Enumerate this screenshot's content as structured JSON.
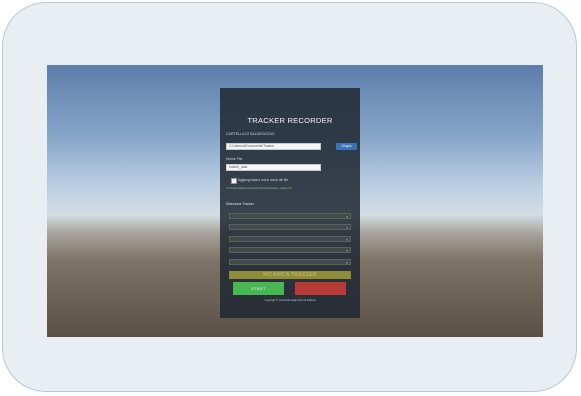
{
  "app": {
    "title": "TRACKER RECORDER"
  },
  "save_folder": {
    "label": "CARTELLA DI SALVATAGGIO",
    "value": "C:/Users/a/Documents/Tracker",
    "browse_label": "Sfoglia"
  },
  "file_name": {
    "label": "Nome File",
    "value": "tracker_data"
  },
  "timestamp_option": {
    "label": "Aggiungi data e ora al nome del file",
    "checked": false
  },
  "path_preview": "C:/Users/a/Documents/Tracker/tracker_data.csv",
  "trackers": {
    "section_label": "Seleziona Tracker",
    "dropdowns": [
      "",
      "",
      "",
      "",
      ""
    ]
  },
  "buttons": {
    "load_label": "RICARICA TRACKER",
    "start_label": "START",
    "stop_label": ""
  },
  "footer": "Copyright © Università degli Studi di Padova",
  "colors": {
    "panel": "#202832",
    "start": "#49b654",
    "stop": "#b83a37",
    "load": "#8f8d3a",
    "browse": "#3a74b8",
    "preview_text": "#7fd07a"
  }
}
